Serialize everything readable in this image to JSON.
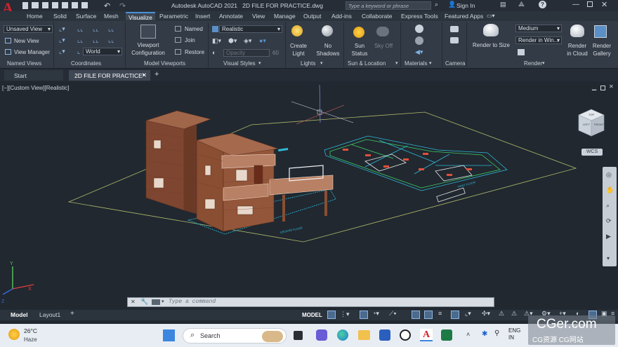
{
  "app": {
    "title": "Autodesk AutoCAD 2021",
    "file": "2D FILE FOR PRACTICE.dwg",
    "search_placeholder": "Type a keyword or phrase",
    "sign_in": "Sign In"
  },
  "ribbon_tabs": [
    "Home",
    "Solid",
    "Surface",
    "Mesh",
    "Visualize",
    "Parametric",
    "Insert",
    "Annotate",
    "View",
    "Manage",
    "Output",
    "Add-ins",
    "Collaborate",
    "Express Tools",
    "Featured Apps"
  ],
  "named_views": {
    "combo": "Unsaved View",
    "new_view": "New View",
    "view_manager": "View Manager",
    "label": "Named Views"
  },
  "coordinates": {
    "world": "World",
    "label": "Coordinates"
  },
  "model_viewports": {
    "viewport_config": "Viewport Configuration",
    "named": "Named",
    "join": "Join",
    "restore": "Restore",
    "label": "Model Viewports"
  },
  "visual_styles": {
    "combo": "Realistic",
    "opacity_label": "Opacity",
    "opacity_value": "60",
    "label": "Visual Styles"
  },
  "lights": {
    "create_light": "Create Light",
    "no_shadows": "No Shadows",
    "label": "Lights"
  },
  "sun_location": {
    "sun_status": "Sun Status",
    "sky_off": "Sky Off",
    "label": "Sun & Location"
  },
  "materials": {
    "label": "Materials"
  },
  "camera": {
    "label": "Camera"
  },
  "render": {
    "render_to_size": "Render to Size",
    "quality": "Medium",
    "render_in": "Render in Win...",
    "render_in_cloud": "Render in Cloud",
    "render_gallery": "Render Gallery",
    "label": "Render"
  },
  "doc_tabs": {
    "start": "Start",
    "file": "2D FILE FOR PRACTICE*"
  },
  "viewport": {
    "view_label": "[−][Custom View][Realistic]",
    "wcs": "WCS",
    "cube_top": "TOP",
    "cube_left": "LEFT",
    "cube_front": "FRONT",
    "plan_label": "FIRST FLOOR",
    "ground_label": "GROUND FLOOR"
  },
  "command": {
    "placeholder": "Type a command"
  },
  "layout_tabs": [
    "Model",
    "Layout1"
  ],
  "status": {
    "model": "MODEL"
  },
  "taskbar": {
    "weather_temp": "26°C",
    "weather_desc": "Haze",
    "search": "Search",
    "lang": "ENG",
    "lang2": "IN"
  },
  "watermark": {
    "main": "CGer.com",
    "sub": "CG资源 CG网站"
  },
  "colors": {
    "accent": "#4a90d9",
    "autocad_red": "#d0232b",
    "brick": "#8a4e32",
    "cyan": "#2fb9d6",
    "grid": "#b0b86a"
  }
}
